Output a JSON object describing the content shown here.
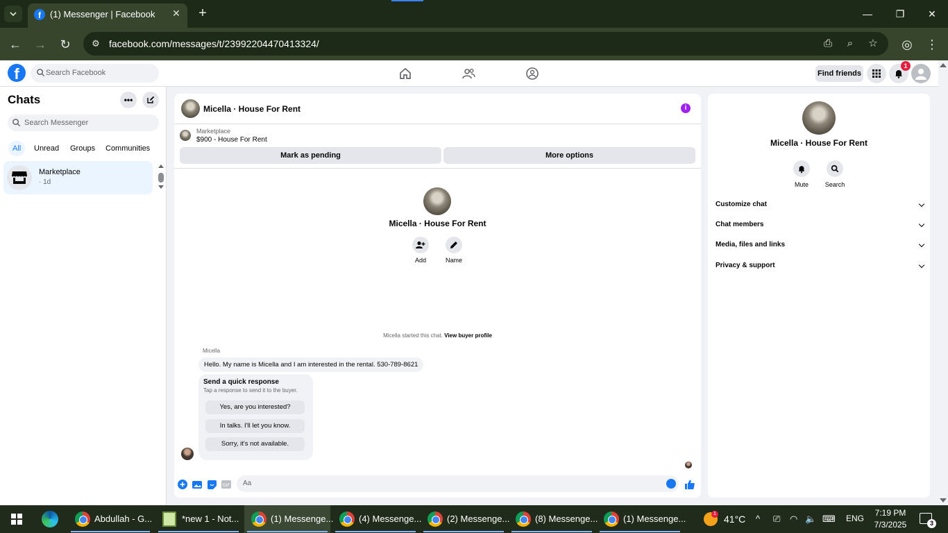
{
  "browser": {
    "tab_title": "(1) Messenger | Facebook",
    "url": "facebook.com/messages/t/23992204470413324/"
  },
  "fb_header": {
    "search_placeholder": "Search Facebook",
    "find_friends": "Find friends",
    "notifications_count": "1"
  },
  "sidebar": {
    "title": "Chats",
    "search_placeholder": "Search Messenger",
    "filters": [
      "All",
      "Unread",
      "Groups",
      "Communities"
    ],
    "active_filter": "All",
    "chats": [
      {
        "name": "Marketplace",
        "time": "· 1d"
      }
    ]
  },
  "conversation": {
    "title": "Micella · House For Rent",
    "listing": {
      "label": "Marketplace",
      "price_title": "$900 - House For Rent",
      "mark_pending": "Mark as pending",
      "more_options": "More options"
    },
    "profile_name": "Micella · House For Rent",
    "actions": [
      {
        "label": "Add",
        "icon": "add-person-icon"
      },
      {
        "label": "Name",
        "icon": "pencil-icon"
      }
    ],
    "started_text": "Micella started this chat.",
    "view_buyer_profile": "View buyer profile",
    "sender": "Micella",
    "message": "Hello. My name is Micella and I am interested in the rental. 530-789-8621",
    "quick_response": {
      "title": "Send a quick response",
      "subtitle": "Tap a response to send it to the buyer.",
      "options": [
        "Yes, are you interested?",
        "In talks. I'll let you know.",
        "Sorry, it's not available."
      ]
    },
    "composer_placeholder": "Aa"
  },
  "info_panel": {
    "name": "Micella · House For Rent",
    "actions": [
      {
        "label": "Mute",
        "icon": "bell-icon"
      },
      {
        "label": "Search",
        "icon": "search-icon"
      }
    ],
    "sections": [
      "Customize chat",
      "Chat members",
      "Media, files and links",
      "Privacy & support"
    ]
  },
  "taskbar": {
    "items": [
      {
        "label": "Abdullah - G...",
        "app": "chrome"
      },
      {
        "label": "*new 1 - Not...",
        "app": "notepad"
      },
      {
        "label": "(1) Messenge...",
        "app": "chrome"
      },
      {
        "label": "(4) Messenge...",
        "app": "chrome"
      },
      {
        "label": "(2) Messenge...",
        "app": "chrome"
      },
      {
        "label": "(8) Messenge...",
        "app": "chrome"
      },
      {
        "label": "(1) Messenge...",
        "app": "chrome"
      }
    ],
    "weather_badge": "1",
    "temperature": "41°C",
    "language": "ENG",
    "time": "7:19 PM",
    "date": "7/3/2025",
    "notification_count": "3"
  },
  "colors": {
    "fb_blue": "#1877f2",
    "chrome_dark": "#1e2a18",
    "chrome_toolbar": "#37452d",
    "info_purple": "#a020f0"
  }
}
